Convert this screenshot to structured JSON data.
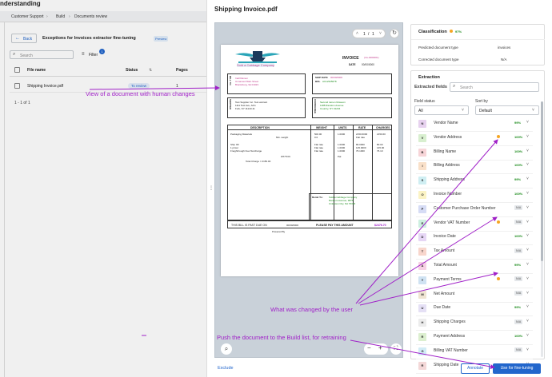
{
  "app": {
    "title": "nderstanding"
  },
  "breadcrumb": [
    "Customer Support",
    "Build",
    "Documents review"
  ],
  "left": {
    "back_label": "Back",
    "page_title": "Exceptions for Invoices extractor fine-tuning",
    "preview_badge": "Preview",
    "search_placeholder": "Search",
    "filter_label": "Filter",
    "filter_count": "1",
    "columns": [
      "File name",
      "Status",
      "Pages"
    ],
    "rows": [
      {
        "file": "Shipping Invoice.pdf",
        "status": "To review",
        "pages": "1"
      }
    ],
    "pagination": "1 - 1 of 1"
  },
  "viewer": {
    "doc_title": "Shipping Invoice.pdf",
    "page_current": "1",
    "page_sep": "/",
    "page_total": "1",
    "exclude_label": "Exclude"
  },
  "invoice": {
    "company_name": "Sold a Cabbage Company",
    "heading": "INVOICE",
    "heading_no": "(Inv-0000001)",
    "date_label": "DATE",
    "date_value": "00/00/0000",
    "bill_to_label": "BILL TO",
    "ship_to_label": "SHIP TO",
    "bill_to_text": "Inall Ramen\nUnnamed Main Street\nBrantsburg, 9A 01023",
    "ship_date_label": "SHIP DATE",
    "bol_label": "BOL",
    "ship_date_value": "00/00/0000",
    "bol_value": "AC12345678",
    "shipper_label": "SHIPPER",
    "shipper_text": "Test Supplier Inc. Test warrant\n1111 Test Ave, Arlin\nFork, NY 11143-11",
    "consignee_label": "CONSIGNEE",
    "consignee_text": "Second ramen Museum\n1188 Random Avenue\nCountry, NY 01234",
    "table_headers": [
      "DESCRIPTION",
      "WEIGHT",
      "UNITS",
      "RATE",
      "CHARGES"
    ],
    "lines": [
      {
        "desc": "Packaging Materials",
        "weight": "500.00",
        "units": "1.0000",
        "rate": "2150.6000",
        "charge": "2150.60"
      },
      {
        "desc": "Min. weight",
        "weight": "0.0",
        "units": "",
        "rate": "Flat rate",
        "charge": ""
      },
      {
        "desc": "Ship OF",
        "weight": "Flat rate",
        "units": "1.0000",
        "rate": "80.0000",
        "charge": "80.00"
      },
      {
        "desc": "1 pricer",
        "weight": "Flat rate",
        "units": "1.0000",
        "rate": "145.0000",
        "charge": "145.00"
      },
      {
        "desc": "Freight/rough Fuel Surcharge",
        "weight": "Flat rate",
        "units": "1.0000",
        "rate": "76.1000",
        "charge": "76.10"
      }
    ],
    "total_line": "Total Charge  =  2150.00",
    "wt_ton": "WT/TON",
    "pal": "Pal",
    "remit_label": "Remit To:",
    "remit_text": "Sold a Cabbage Company\nRandom Avenue, 9876\nUnknown City, NA 76333",
    "bill_past_due": "THIS BILL IS PAST DUE ON",
    "past_due_date": "00/00/0000",
    "pay_amount": "PLEASE PAY THIS AMOUNT",
    "amount_value": "$2476.70",
    "powered": "Powered By"
  },
  "panel": {
    "classification_title": "Classification",
    "classification_conf": "97%",
    "predicted_label": "Predicted document type",
    "predicted_value": "invoices",
    "corrected_label": "Corrected document type",
    "corrected_value": "N/A",
    "extraction_title": "Extraction",
    "extracted_fields_label": "Extracted fields",
    "search_placeholder": "Search",
    "field_status_label": "Field status",
    "field_status_value": "All",
    "sort_by_label": "Sort by",
    "sort_by_value": "Default",
    "annotate_label": "Annotate",
    "fine_tune_label": "Use for fine-tuning"
  },
  "fields": [
    {
      "letter": "N",
      "name": "Vendor Name",
      "conf": "99%",
      "color": "#e7d2ef",
      "dot": false
    },
    {
      "letter": "V",
      "name": "Vendor Address",
      "conf": "100%",
      "color": "#d8efcf",
      "dot": true
    },
    {
      "letter": "B",
      "name": "Billing Name",
      "conf": "100%",
      "color": "#f7d5d8",
      "dot": false
    },
    {
      "letter": "I",
      "name": "Billing Address",
      "conf": "100%",
      "color": "#f9e0c9",
      "dot": false
    },
    {
      "letter": "S",
      "name": "Shipping Address",
      "conf": "99%",
      "color": "#cfeef2",
      "dot": false
    },
    {
      "letter": "O",
      "name": "Invoice Number",
      "conf": "100%",
      "color": "#fbf3c4",
      "dot": false
    },
    {
      "letter": "P",
      "name": "Customer Purchase Order Number",
      "conf": "N/A",
      "color": "#d6dcf5",
      "dot": false
    },
    {
      "letter": "E",
      "name": "Vendor VAT Number",
      "conf": "N/A",
      "color": "#cdefe0",
      "dot": true
    },
    {
      "letter": "D",
      "name": "Invoice Date",
      "conf": "100%",
      "color": "#e6d6f5",
      "dot": false
    },
    {
      "letter": "T",
      "name": "Tax Amount",
      "conf": "N/A",
      "color": "#f8d6cc",
      "dot": false
    },
    {
      "letter": "A",
      "name": "Total Amount",
      "conf": "99%",
      "color": "#f6d0e4",
      "dot": false
    },
    {
      "letter": "Y",
      "name": "Payment Terms",
      "conf": "N/A",
      "color": "#cfe2f2",
      "dot": true
    },
    {
      "letter": "M",
      "name": "Net Amount",
      "conf": "N/A",
      "color": "#efe4d2",
      "dot": false
    },
    {
      "letter": "U",
      "name": "Due Date",
      "conf": "99%",
      "color": "#e5e0f5",
      "dot": false
    },
    {
      "letter": "H",
      "name": "Shipping Charges",
      "conf": "N/A",
      "color": "#ececec",
      "dot": false
    },
    {
      "letter": "R",
      "name": "Payment Address",
      "conf": "100%",
      "color": "#dcefcf",
      "dot": false
    },
    {
      "letter": "G",
      "name": "Billing VAT Number",
      "conf": "N/A",
      "color": "#d2ecf6",
      "dot": false
    },
    {
      "letter": "R",
      "name": "Shipping Date",
      "conf": "100%",
      "color": "#f4d8d8",
      "dot": false
    }
  ],
  "annotations": {
    "view_doc": "View of a document with human changes",
    "changed": "What was changed by the user",
    "push": "Push the document to the Build list, for retraining",
    "color": "#a020c8"
  }
}
